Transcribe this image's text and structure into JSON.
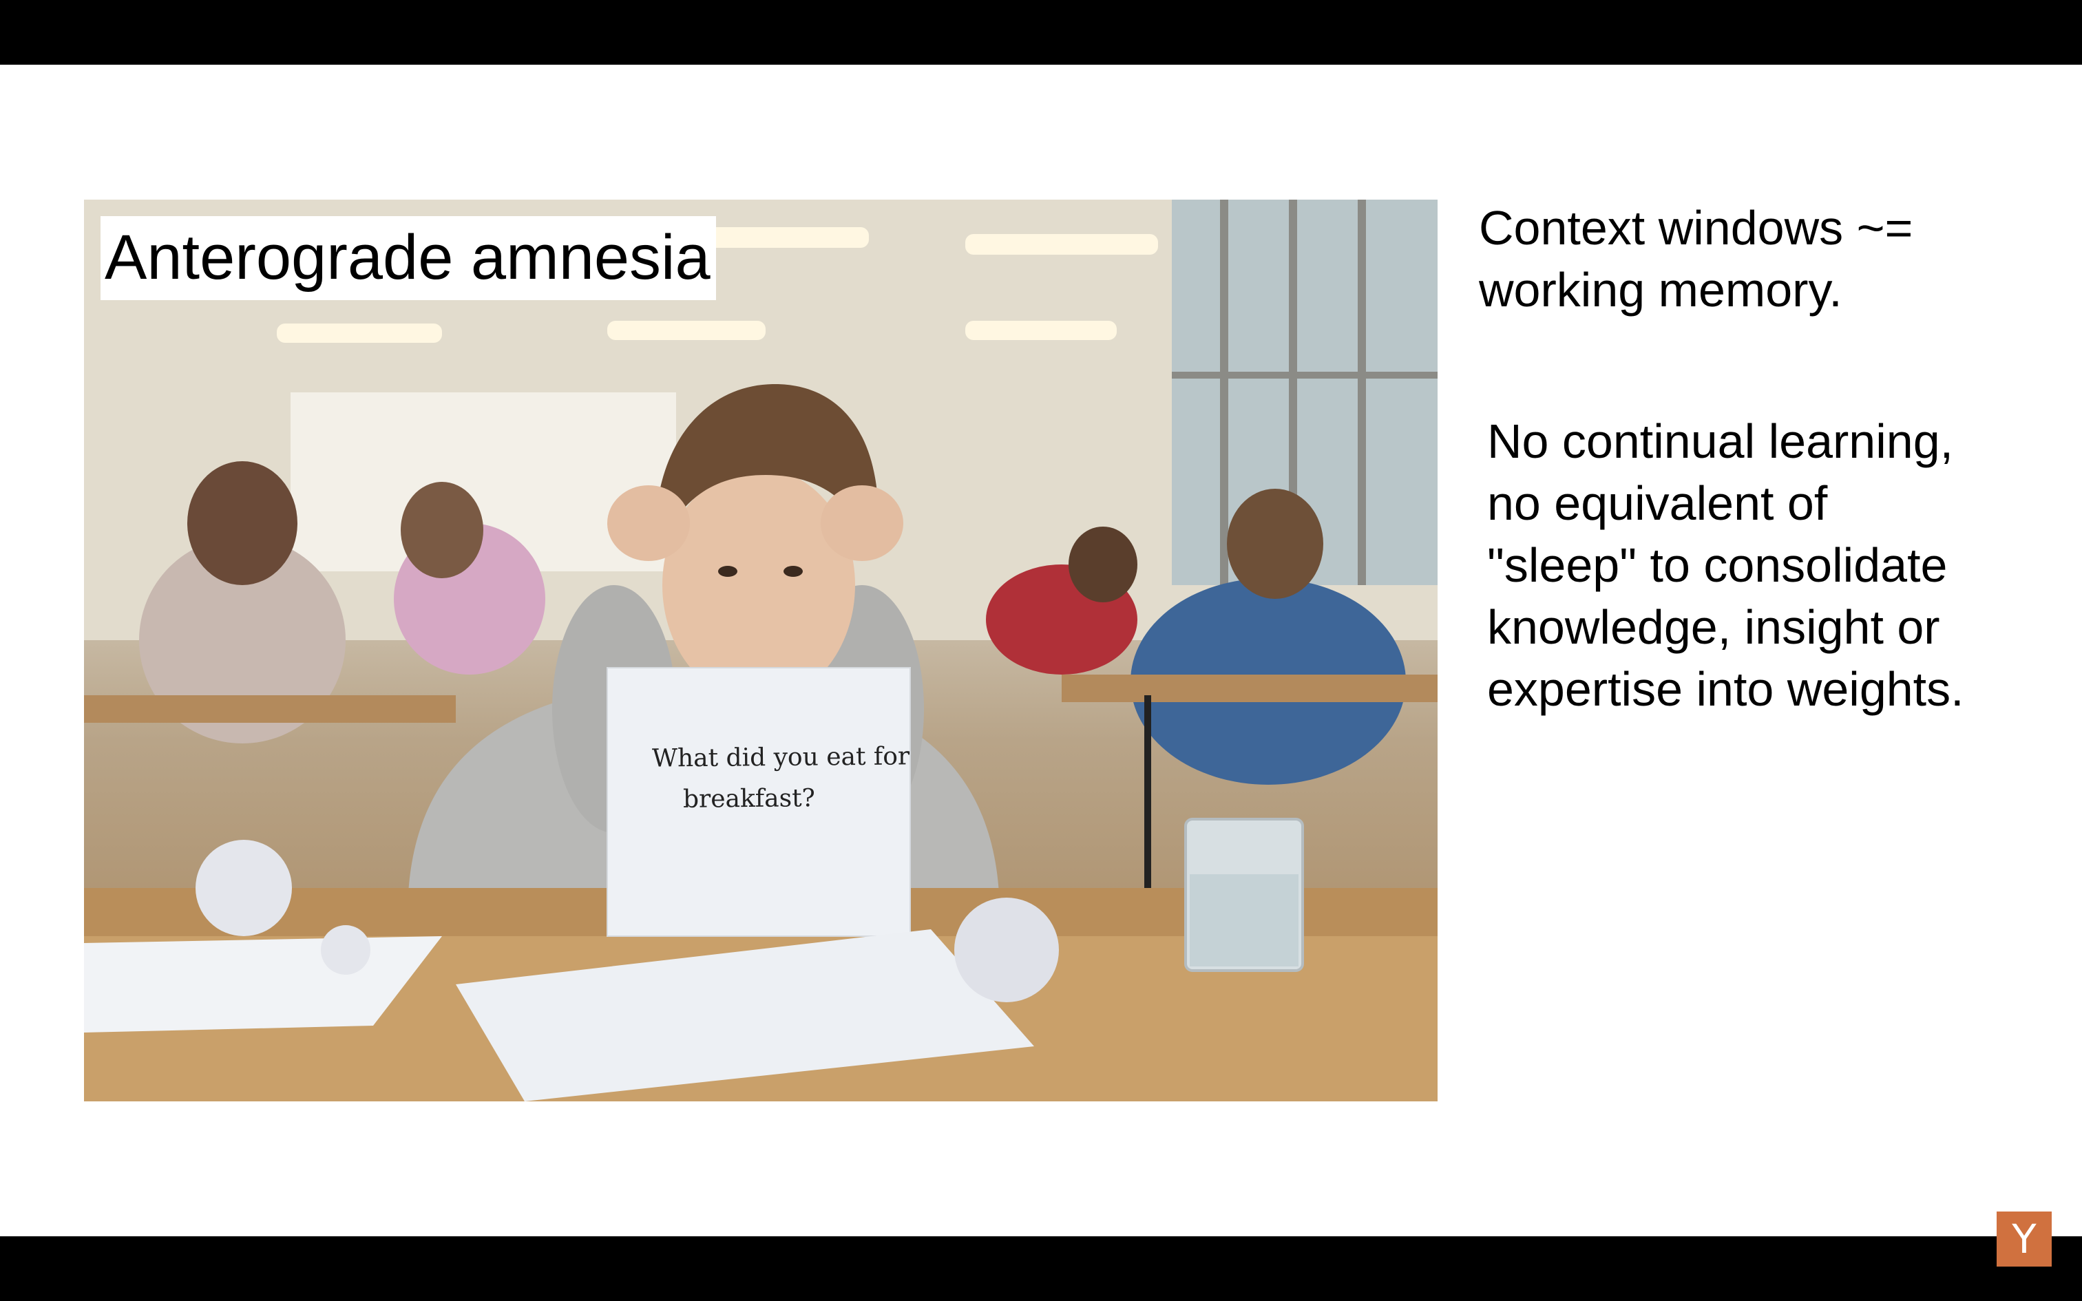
{
  "slide": {
    "image_label": "Anterograde amnesia",
    "sign_lines": [
      "What did you eat for",
      "breakfast?"
    ],
    "points": [
      {
        "lines": [
          "Context windows ~=",
          "working memory."
        ]
      },
      {
        "lines": [
          "No continual learning,",
          "no equivalent of",
          "\"sleep\" to consolidate",
          "knowledge, insight or",
          "expertise into weights."
        ]
      }
    ]
  },
  "branding": {
    "logo_letter": "Y",
    "logo_color": "#d0713f"
  },
  "icons": {
    "photo": "classroom-photo",
    "logo": "ycombinator-logo-icon"
  }
}
